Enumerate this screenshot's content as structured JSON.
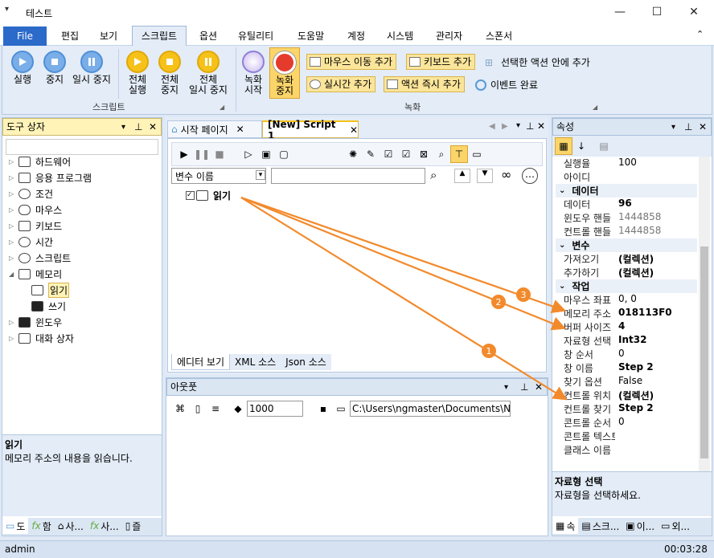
{
  "window": {
    "title": "테스트",
    "quick_access": "▾",
    "buttons": [
      "—",
      "☐",
      "✕"
    ]
  },
  "menu": {
    "file": "File",
    "items": [
      "편집",
      "보기",
      "스크립트",
      "옵션",
      "유틸리티",
      "도움말",
      "계정",
      "시스템",
      "관리자",
      "스폰서"
    ],
    "collapse": "⌃"
  },
  "ribbon": {
    "script_group": "스크립트",
    "record_group": "녹화",
    "run": "실행",
    "stop": "중지",
    "pause": "일시 중지",
    "run_all_1": "전체",
    "run_all_2": "실행",
    "stop_all_1": "전체",
    "stop_all_2": "중지",
    "pause_all_1": "전체",
    "pause_all_2": "일시 중지",
    "rec_start_1": "녹화",
    "rec_start_2": "시작",
    "rec_stop_1": "녹화",
    "rec_stop_2": "중지",
    "mouse_move": "마우스 이동 추가",
    "keyboard_add": "키보드 추가",
    "selected_action": "선택한 액션 안에 추가",
    "realtime_add": "실시간 추가",
    "action_add": "액션 즉시 추가",
    "event_done": "이벤트 완료"
  },
  "toolbox": {
    "title": "도구 상자",
    "items": [
      {
        "label": "하드웨어",
        "exp": "▷"
      },
      {
        "label": "응용 프로그램",
        "exp": "▷"
      },
      {
        "label": "조건",
        "exp": "▷"
      },
      {
        "label": "마우스",
        "exp": "▷"
      },
      {
        "label": "키보드",
        "exp": "▷"
      },
      {
        "label": "시간",
        "exp": "▷"
      },
      {
        "label": "스크립트",
        "exp": "▷"
      },
      {
        "label": "메모리",
        "exp": "◢"
      }
    ],
    "children": [
      "읽기",
      "쓰기"
    ],
    "items_after": [
      {
        "label": "윈도우",
        "exp": "▷"
      },
      {
        "label": "대화 상자",
        "exp": "▷"
      }
    ],
    "desc_title": "읽기",
    "desc_text": "메모리 주소의 내용을 읽습니다.",
    "bottom_tabs": [
      "도",
      "함",
      "사...",
      "사...",
      "즐"
    ]
  },
  "editor": {
    "tabs": [
      "시작 페이지",
      "[New] Script 1"
    ],
    "var_select": "변수 이름",
    "node": "읽기",
    "view_tabs": [
      "에디터 보기",
      "XML 소스",
      "Json 소스"
    ]
  },
  "output": {
    "title": "아웃풋",
    "count": "1000",
    "path": "C:\\Users\\ngmaster\\Documents\\NGM"
  },
  "properties": {
    "title": "속성",
    "rows_top": [
      {
        "k": "실행율",
        "v": "100"
      },
      {
        "k": "아이디",
        "v": ""
      }
    ],
    "cat_data": "데이터",
    "rows_data": [
      {
        "k": "데이터",
        "v": "96",
        "bold": true
      },
      {
        "k": "윈도우 핸들",
        "v": "1444858",
        "gray": true
      },
      {
        "k": "컨트롤 핸들",
        "v": "1444858",
        "gray": true
      }
    ],
    "cat_var": "변수",
    "rows_var": [
      {
        "k": "가져오기",
        "v": "(컬렉션)",
        "bold": true
      },
      {
        "k": "추가하기",
        "v": "(컬렉션)",
        "bold": true
      }
    ],
    "cat_work": "작업",
    "rows_work": [
      {
        "k": "마우스 좌표",
        "v": "0, 0"
      },
      {
        "k": "메모리 주소",
        "v": "018113F0",
        "bold": true
      },
      {
        "k": "버퍼 사이즈",
        "v": "4",
        "bold": true
      },
      {
        "k": "자료형 선택",
        "v": "Int32",
        "bold": true
      },
      {
        "k": "창 순서",
        "v": "0"
      },
      {
        "k": "창 이름",
        "v": "Step 2",
        "bold": true
      },
      {
        "k": "찾기 옵션",
        "v": "False"
      },
      {
        "k": "컨트롤 위치",
        "v": "(컬렉션)",
        "bold": true
      },
      {
        "k": "컨트롤 찾기",
        "v": "Step 2",
        "bold": true
      },
      {
        "k": "콘트롤 순서",
        "v": "0"
      },
      {
        "k": "콘트롤 텍스트",
        "v": ""
      },
      {
        "k": "클래스 이름",
        "v": ""
      }
    ],
    "desc_title": "자료형 선택",
    "desc_text": "자료형을 선택하세요.",
    "bottom_tabs": [
      "속",
      "스크...",
      "이...",
      "외..."
    ]
  },
  "callouts": [
    "1",
    "2",
    "3"
  ],
  "status": {
    "user": "admin",
    "time": "00:03:28"
  },
  "colors": {
    "accent": "#2b6ac9",
    "arrow": "#f28a2c",
    "panel_header": "#fff3b8"
  }
}
